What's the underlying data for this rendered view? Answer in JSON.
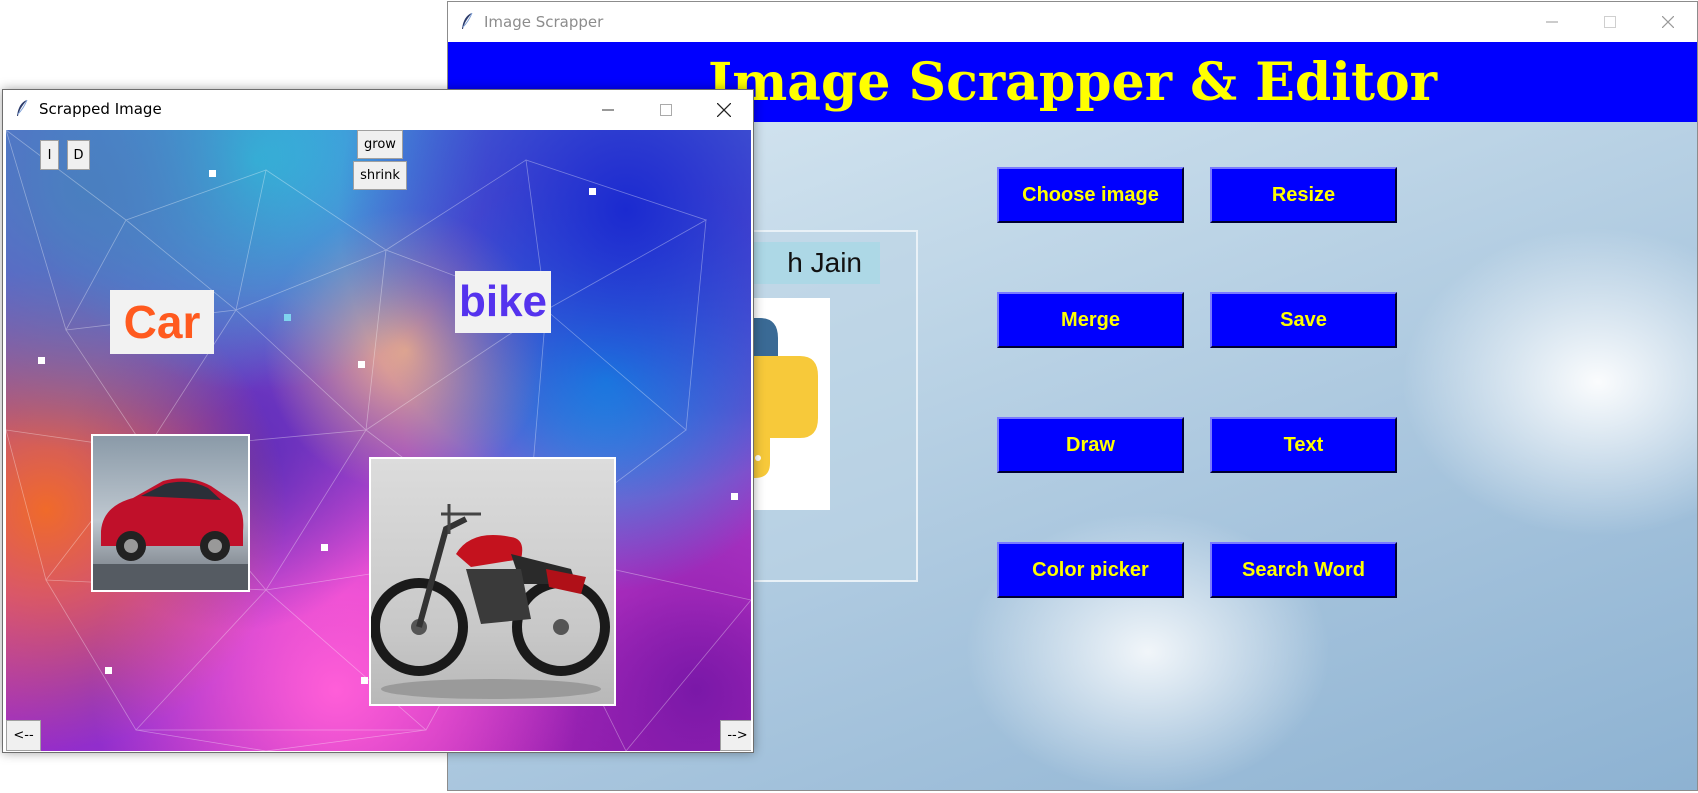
{
  "main_window": {
    "title": "Image Scrapper",
    "header": "Image Scrapper & Editor",
    "name_fragment": "h Jain",
    "buttons": [
      {
        "label": "Choose image"
      },
      {
        "label": "Resize"
      },
      {
        "label": "Merge"
      },
      {
        "label": "Save"
      },
      {
        "label": "Draw"
      },
      {
        "label": "Text"
      },
      {
        "label": "Color picker"
      },
      {
        "label": "Search Word"
      }
    ],
    "colors": {
      "header_bg": "#0000ff",
      "header_text": "#ffff00",
      "button_bg": "#0000ff",
      "button_text": "#ffff00"
    }
  },
  "scrap_window": {
    "title": "Scrapped Image",
    "controls": {
      "i": "I",
      "d": "D",
      "grow": "grow",
      "shrink": "shrink",
      "prev": "<--",
      "next": "-->"
    },
    "labels": {
      "car": "Car",
      "bike": "bike"
    },
    "colors": {
      "car_label": "#ff5a1f",
      "bike_label": "#5533ee"
    }
  },
  "icons": [
    "feather-icon",
    "minimize-icon",
    "maximize-icon",
    "close-icon",
    "python-logo-icon",
    "car-photo",
    "motorcycle-photo"
  ]
}
